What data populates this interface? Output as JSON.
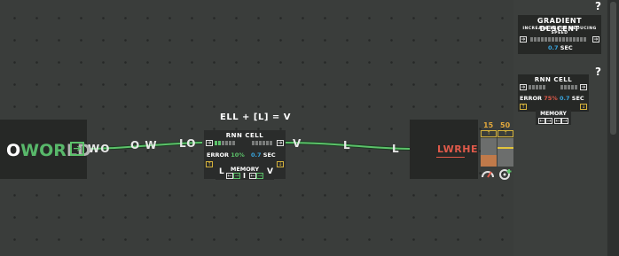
{
  "input_node": {
    "word_parts": [
      {
        "text": "O",
        "style": "w"
      },
      {
        "text": "WOR",
        "style": "g"
      },
      {
        "text": "LD",
        "style": "a"
      }
    ],
    "arrow_icon": "arrow-right-icon"
  },
  "wire_labels": [
    "WO",
    "O W",
    "LO",
    "V",
    "L",
    "L"
  ],
  "rnn_main": {
    "formula": "ELL + [L] = V",
    "title": "RNN CELL",
    "error_label": "ERROR",
    "error_value": "10%",
    "time_value": "0.7",
    "time_unit": "SEC",
    "memory_label": "MEMORY",
    "mem_left": "L",
    "mem_mid": "I",
    "mem_right": "V"
  },
  "output_node": {
    "word": "LWRHE",
    "meter_left_value": "15",
    "meter_right_value": "50"
  },
  "panel": {
    "help_glyph": "?",
    "gradient_card": {
      "title": "GRADIENT DESCENT",
      "subtitle": "INCREASE ERROR REDUCING SPEED",
      "time_value": "0.7",
      "time_unit": "SEC"
    },
    "rnn_card": {
      "title": "RNN CELL",
      "error_label": "ERROR",
      "error_value": "75%",
      "time_value": "0.7",
      "time_unit": "SEC",
      "memory_label": "MEMORY"
    }
  },
  "colors": {
    "accent_green": "#5cc26a",
    "error_red": "#e05a4a",
    "info_blue": "#38a6e0",
    "warn_yellow": "#d6b33c"
  }
}
